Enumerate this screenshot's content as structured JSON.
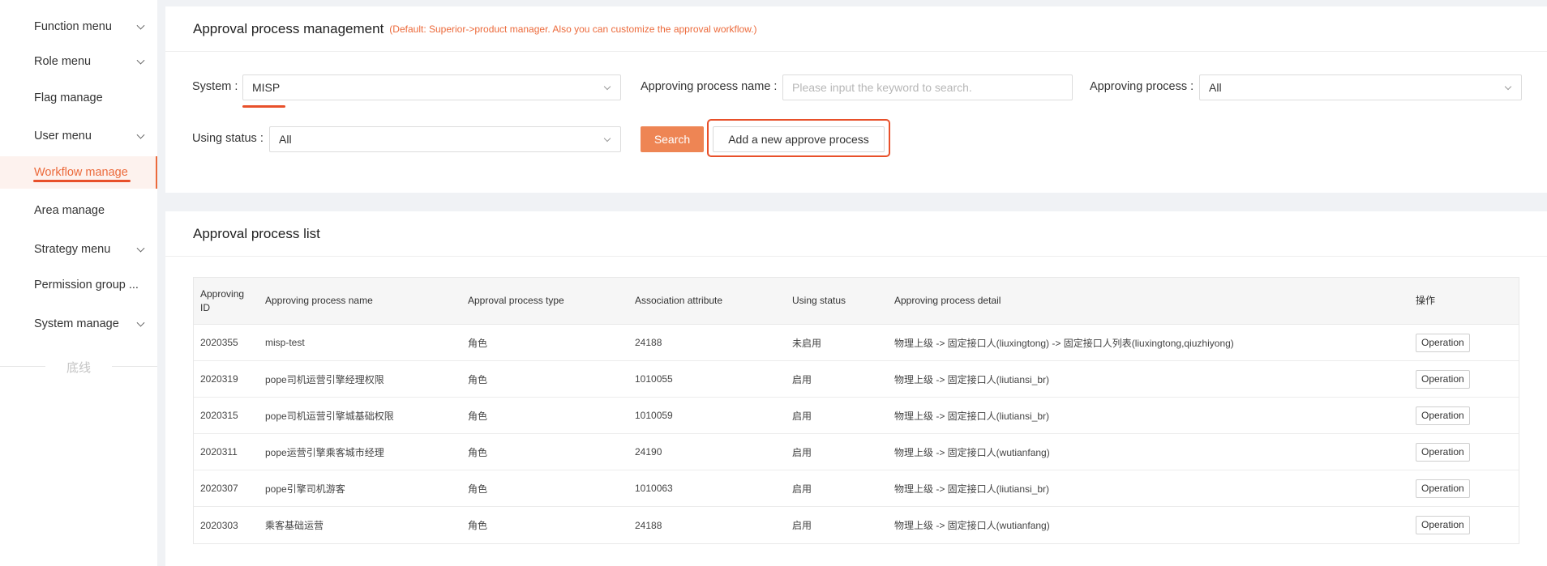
{
  "sidebar": {
    "items": [
      {
        "label": "Function menu",
        "has_submenu": true
      },
      {
        "label": "Role menu",
        "has_submenu": true
      },
      {
        "label": "Flag manage",
        "has_submenu": false
      },
      {
        "label": "User menu",
        "has_submenu": true
      },
      {
        "label": "Workflow manage",
        "has_submenu": false,
        "active": true
      },
      {
        "label": "Area manage",
        "has_submenu": false
      },
      {
        "label": "Strategy menu",
        "has_submenu": true
      },
      {
        "label": "Permission group ...",
        "has_submenu": false
      },
      {
        "label": "System manage",
        "has_submenu": true
      }
    ],
    "bottom_text": "底线"
  },
  "search_panel": {
    "title": "Approval process management",
    "note": "(Default: Superior->product manager. Also you can customize the approval workflow.)",
    "system_label": "System :",
    "system_value": "MISP",
    "process_name_label": "Approving process name :",
    "process_name_placeholder": "Please input the keyword to search.",
    "approving_process_label": "Approving process :",
    "approving_process_value": "All",
    "using_status_label": "Using status :",
    "using_status_value": "All",
    "search_button": "Search",
    "add_button": "Add a new approve process"
  },
  "list_panel": {
    "title": "Approval process list",
    "columns": [
      "Approving ID",
      "Approving process name",
      "Approval process type",
      "Association attribute",
      "Using status",
      "Approving process detail",
      "操作"
    ],
    "rows": [
      {
        "id": "2020355",
        "name": "misp-test",
        "type": "角色",
        "attr": "24188",
        "status": "未启用",
        "detail": "物理上级 -> 固定接口人(liuxingtong) -> 固定接口人列表(liuxingtong,qiuzhiyong)",
        "op": "Operation"
      },
      {
        "id": "2020319",
        "name": "pope司机运营引擎经理权限",
        "type": "角色",
        "attr": "1010055",
        "status": "启用",
        "detail": "物理上级 -> 固定接口人(liutiansi_br)",
        "op": "Operation"
      },
      {
        "id": "2020315",
        "name": "pope司机运营引擎城基础权限",
        "type": "角色",
        "attr": "1010059",
        "status": "启用",
        "detail": "物理上级 -> 固定接口人(liutiansi_br)",
        "op": "Operation"
      },
      {
        "id": "2020311",
        "name": "pope运营引擎乘客城市经理",
        "type": "角色",
        "attr": "24190",
        "status": "启用",
        "detail": "物理上级 -> 固定接口人(wutianfang)",
        "op": "Operation"
      },
      {
        "id": "2020307",
        "name": "pope引擎司机游客",
        "type": "角色",
        "attr": "1010063",
        "status": "启用",
        "detail": "物理上级 -> 固定接口人(liutiansi_br)",
        "op": "Operation"
      },
      {
        "id": "2020303",
        "name": "乘客基础运营",
        "type": "角色",
        "attr": "24188",
        "status": "启用",
        "detail": "物理上级 -> 固定接口人(wutianfang)",
        "op": "Operation"
      }
    ]
  },
  "colors": {
    "accent": "#ec6a3b",
    "search_button": "#ee8554",
    "annotation_red": "#e8502a"
  },
  "icons": {
    "chevron": "chevron-down-icon"
  }
}
